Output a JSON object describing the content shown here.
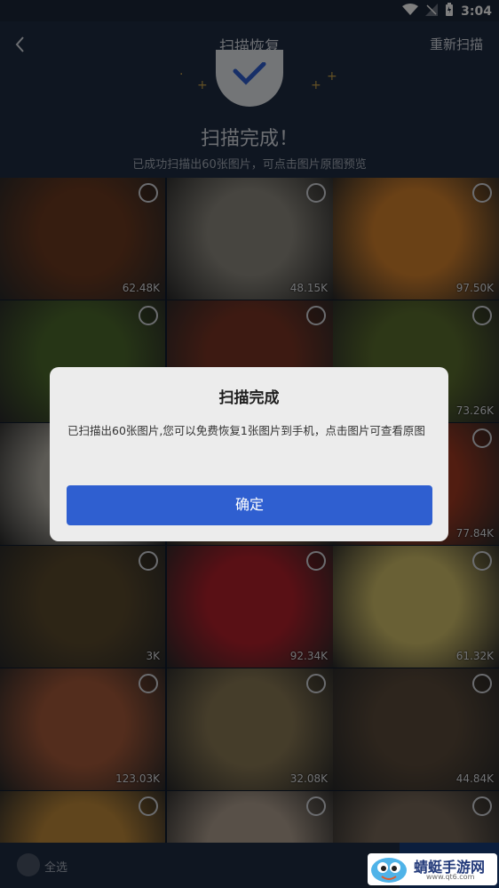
{
  "status_bar": {
    "time": "3:04"
  },
  "header": {
    "title": "扫描恢复",
    "rescan_label": "重新扫描"
  },
  "result": {
    "heading": "扫描完成！",
    "subtitle": "已成功扫描出60张图片，可点击图片原图预览"
  },
  "thumbnails": [
    {
      "size": "62.48K",
      "color": "#6d3a20"
    },
    {
      "size": "48.15K",
      "color": "#8e8a80"
    },
    {
      "size": "97.50K",
      "color": "#d5822c"
    },
    {
      "size": "",
      "color": "#4d6a2c"
    },
    {
      "size": "",
      "color": "#7b3525"
    },
    {
      "size": "73.26K",
      "color": "#5b6e2e"
    },
    {
      "size": "",
      "color": "#b8b4aa"
    },
    {
      "size": "",
      "color": "#9a6a40"
    },
    {
      "size": "77.84K",
      "color": "#a23a22"
    },
    {
      "size": "3K",
      "color": "#5b4a2c"
    },
    {
      "size": "92.34K",
      "color": "#b3202a"
    },
    {
      "size": "61.32K",
      "color": "#d2c06a"
    },
    {
      "size": "123.03K",
      "color": "#a65a3a"
    },
    {
      "size": "32.08K",
      "color": "#8b7a55"
    },
    {
      "size": "44.84K",
      "color": "#5a4a3a"
    },
    {
      "size": "",
      "color": "#c08a3a"
    },
    {
      "size": "",
      "color": "#b0a090"
    },
    {
      "size": "",
      "color": "#7a6a5a"
    }
  ],
  "bottom_bar": {
    "select_all_label": "全选"
  },
  "dialog": {
    "title": "扫描完成",
    "message": "已扫描出60张图片,您可以免费恢复1张图片到手机，点击图片可查看原图",
    "ok_label": "确定"
  },
  "watermark": {
    "name": "蜻蜓手游网",
    "url": "www.qt6.com"
  },
  "colors": {
    "primary_button": "#2f5fd0",
    "header_bg": "#1e2c42"
  }
}
